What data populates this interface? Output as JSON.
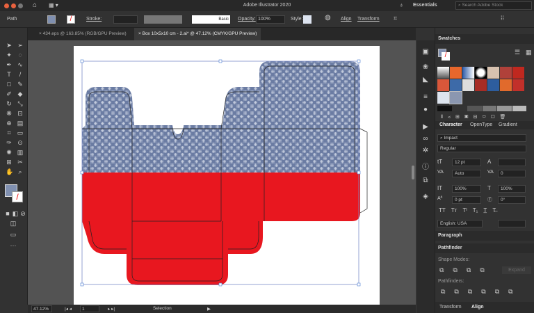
{
  "app": {
    "title": "Adobe Illustrator 2020",
    "workspace": "Essentials",
    "search_placeholder": "Search Adobe Stock"
  },
  "control": {
    "selection_type": "Path",
    "stroke_label": "Stroke:",
    "brush": "Basic",
    "opacity_label": "Opacity:",
    "opacity": "100%",
    "style_label": "Style:",
    "align": "Align",
    "transform": "Transform"
  },
  "tabs": [
    {
      "label": "434.eps @ 163.85% (RGB/GPU Preview)",
      "active": false
    },
    {
      "label": "Box 10x5x10 cm - 2.ai* @ 47.12% (CMYK/GPU Preview)",
      "active": true
    }
  ],
  "status": {
    "zoom": "47.12%",
    "artboard": "1",
    "tool": "Selection"
  },
  "swatches": {
    "title": "Swatches"
  },
  "character": {
    "tabs": [
      "Character",
      "OpenType",
      "Gradient"
    ],
    "font": "Impact",
    "style": "Regular",
    "size": "12 pt",
    "leading": "",
    "kerning": "Auto",
    "tracking": "0",
    "vscale": "100%",
    "hscale": "100%",
    "baseline": "0 pt",
    "rotation": "0°",
    "language": "English: USA"
  },
  "paragraph": {
    "title": "Paragraph"
  },
  "pathfinder": {
    "title": "Pathfinder",
    "shape_modes": "Shape Modes:",
    "expand": "Expand",
    "pathfinders": "Pathfinders:"
  },
  "bottom_tabs": [
    "Transform",
    "Align"
  ],
  "colors": {
    "pattern": "#6b7ca3",
    "red": "#e8171f",
    "canvas": "#535353",
    "selection": "#4a7bd0"
  }
}
